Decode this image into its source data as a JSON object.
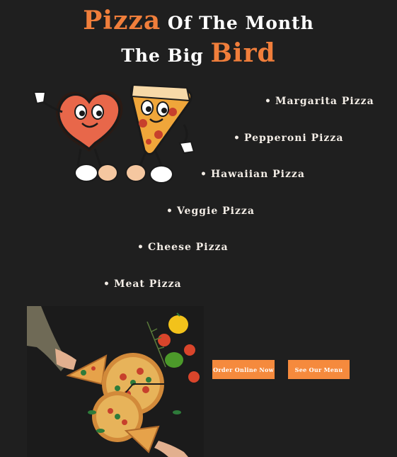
{
  "header": {
    "line1_accent": "Pizza",
    "line1_rest": "Of The Month",
    "line2_rest": "The Big",
    "line2_accent": "Bird"
  },
  "menu": {
    "bullet": "•",
    "items": [
      "Margarita Pizza",
      "Pepperoni Pizza",
      "Hawaiian Pizza",
      "Veggie Pizza",
      "Cheese Pizza",
      "Meat Pizza"
    ]
  },
  "actions": {
    "order_label": "Order Online Now",
    "menu_label": "See Our Menu"
  },
  "colors": {
    "background": "#1f1f1f",
    "accent": "#f07e3b",
    "button": "#f58a3d",
    "text": "#ffffff"
  }
}
